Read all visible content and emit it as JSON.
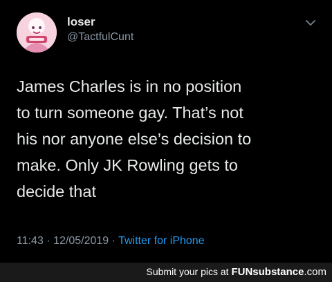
{
  "tweet": {
    "user": {
      "name": "loser",
      "handle": "@TactfulCunt"
    },
    "text_lines": [
      "James Charles is in no position",
      "to turn someone gay. That’s not",
      "his nor anyone else’s decision to",
      "make. Only JK Rowling gets to",
      "decide that"
    ],
    "meta": {
      "time": "11:43",
      "separator": " · ",
      "date": "12/05/2019",
      "source": "Twitter for iPhone"
    },
    "menu_icon": "chevron-down-icon"
  },
  "footer": {
    "prompt": "Submit your pics at",
    "brand_prefix": "FUN",
    "brand_main": "substance",
    "brand_suffix": ".com"
  },
  "colors": {
    "background": "#000000",
    "text": "#e7e9ea",
    "secondary": "#8b98a5",
    "link": "#1d9bf0",
    "footer_bg": "#1a1a1a"
  }
}
